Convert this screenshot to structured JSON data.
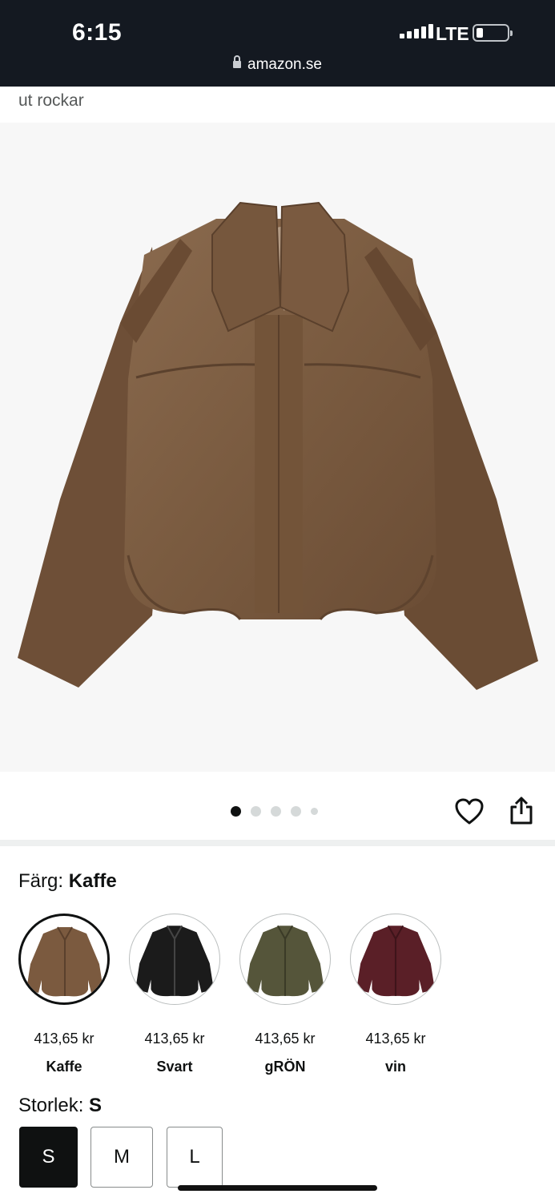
{
  "status_bar": {
    "time": "6:15",
    "network": "LTE",
    "url": "amazon.se"
  },
  "product": {
    "title_fragment": "ut rockar",
    "image_count": 5,
    "active_image": 1
  },
  "color": {
    "label": "Färg:",
    "selected": "Kaffe",
    "options": [
      {
        "price": "413,65 kr",
        "name": "Kaffe",
        "hex": "#7b5a3f"
      },
      {
        "price": "413,65 kr",
        "name": "Svart",
        "hex": "#1b1b1b"
      },
      {
        "price": "413,65 kr",
        "name": "gRÖN",
        "hex": "#55553a"
      },
      {
        "price": "413,65 kr",
        "name": "vin",
        "hex": "#5a1f27"
      }
    ]
  },
  "size": {
    "label": "Storlek:",
    "selected": "S",
    "options": [
      "S",
      "M",
      "L"
    ]
  },
  "icons": {
    "favorite": "heart-icon",
    "share": "share-icon",
    "secure": "lock-icon"
  }
}
